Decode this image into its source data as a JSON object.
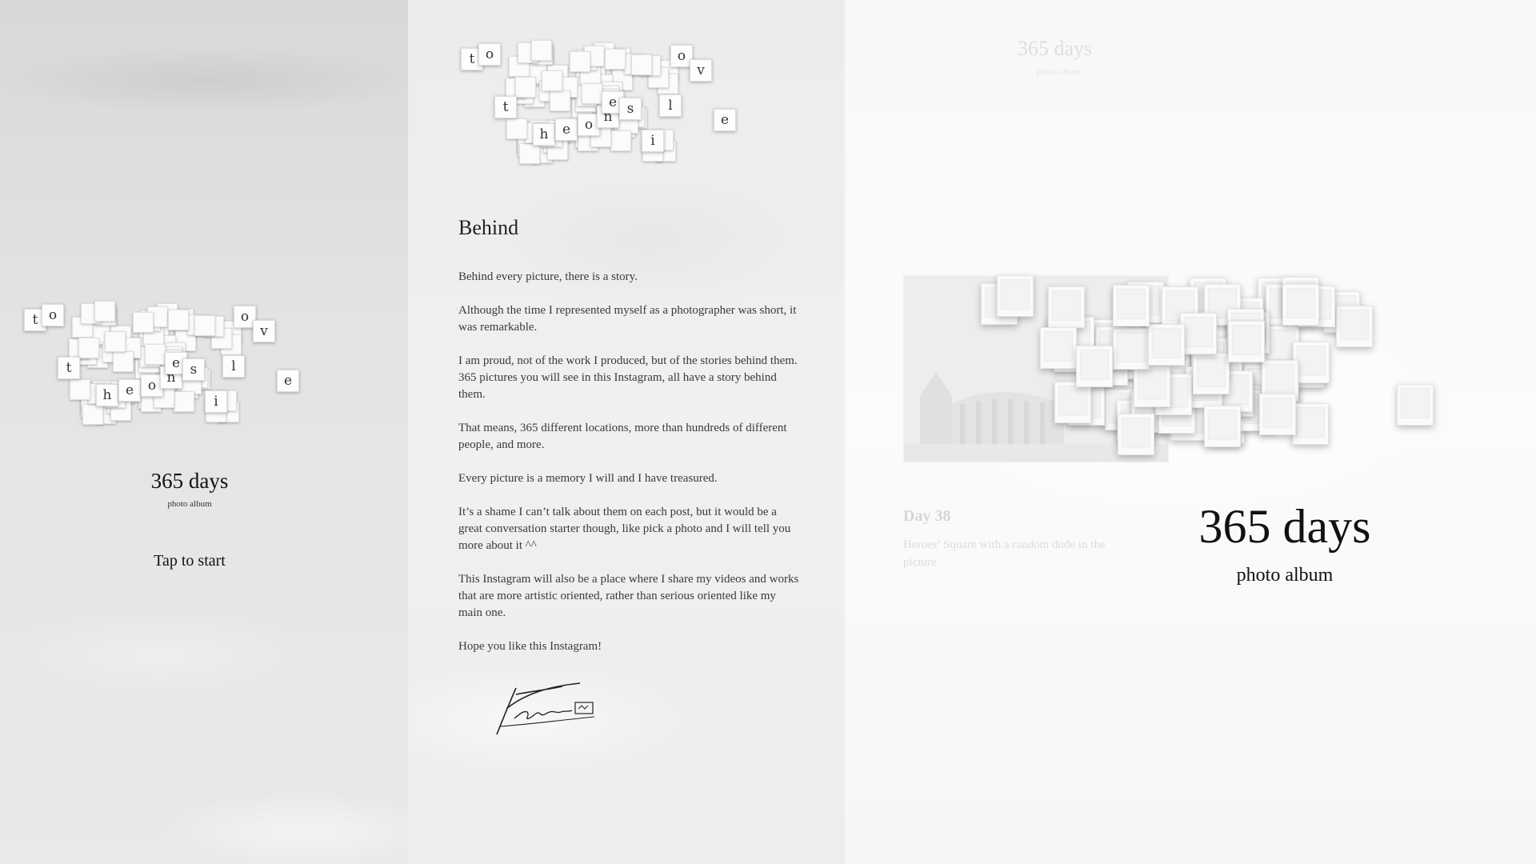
{
  "splash": {
    "title": "365 days",
    "subtitle": "photo album",
    "tap_label": "Tap to start",
    "letters": [
      "t",
      "o",
      "o",
      "v",
      "t",
      "h",
      "e",
      "o",
      "n",
      "e",
      "s",
      "l",
      "i",
      "e"
    ]
  },
  "about": {
    "heading": "Behind",
    "paragraphs": [
      "Behind every picture, there is a story.",
      "Although the time I represented myself as a photographer was short, it was remarkable.",
      "I am proud, not of the work I produced, but of the stories behind them. 365 pictures you will see in this Instagram, all have a story behind them.",
      "That means, 365 different locations, more than hundreds of different people, and more.",
      "Every picture is a memory I will and I have treasured.",
      "It’s a shame I can’t talk about them on each post, but it would be a great conversation starter though, like pick a photo and I will tell you more about it ^^",
      "This Instagram will also be a place where I share my videos and works that are more artistic oriented, rather than serious oriented like my main one.",
      "Hope you like this Instagram!"
    ]
  },
  "album": {
    "ghost_title": "365 days",
    "ghost_subtitle": "photo album",
    "day_label": "Day 38",
    "day_caption": "Heroes’ Square with a random dude in the picture",
    "title": "365 days",
    "subtitle": "photo album"
  }
}
